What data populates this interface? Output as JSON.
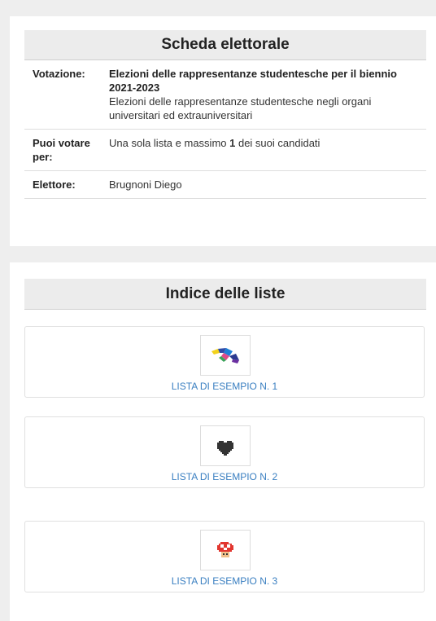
{
  "ballot": {
    "title": "Scheda elettorale",
    "rows": {
      "votazione": {
        "label": "Votazione:",
        "title": "Elezioni delle rappresentanze studentesche per il biennio 2021-2023",
        "description": "Elezioni delle rappresentanze studentesche negli organi universitari ed extrauniversitari"
      },
      "puoi_votare": {
        "label": "Puoi votare per:",
        "text_before": "Una sola lista e massimo ",
        "max_count": "1",
        "text_after": " dei suoi candidati"
      },
      "elettore": {
        "label": "Elettore:",
        "value": "Brugnoni Diego"
      }
    }
  },
  "lists_index": {
    "title": "Indice delle liste",
    "items": [
      {
        "label": "LISTA DI ESEMPIO N. 1",
        "logo_icon": "colorful-bird-logo-icon"
      },
      {
        "label": "LISTA DI ESEMPIO N. 2",
        "logo_icon": "black-heart-logo-icon"
      },
      {
        "label": "LISTA DI ESEMPIO N. 3",
        "logo_icon": "red-mushroom-logo-icon"
      }
    ]
  },
  "colors": {
    "link": "#3a7fc1",
    "page_background": "#eeeeee",
    "header_background": "#ececec"
  }
}
